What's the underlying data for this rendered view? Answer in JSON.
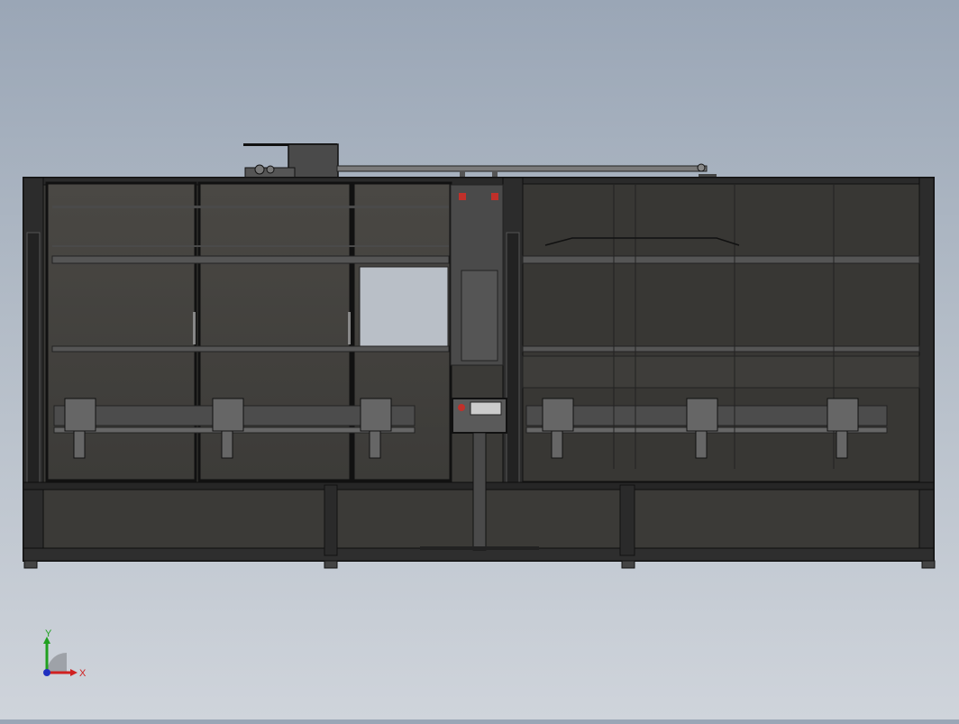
{
  "viewport": {
    "background_top": "#9aa6b6",
    "background_bottom": "#cfd4db",
    "model_fill": "#3a3936",
    "frame_color": "#1c1c1c",
    "accent_red": "#c0302a"
  },
  "triad": {
    "x_label": "X",
    "y_label": "Y",
    "x_color": "#d02020",
    "y_color": "#20a020",
    "origin_color": "#2030c0"
  }
}
